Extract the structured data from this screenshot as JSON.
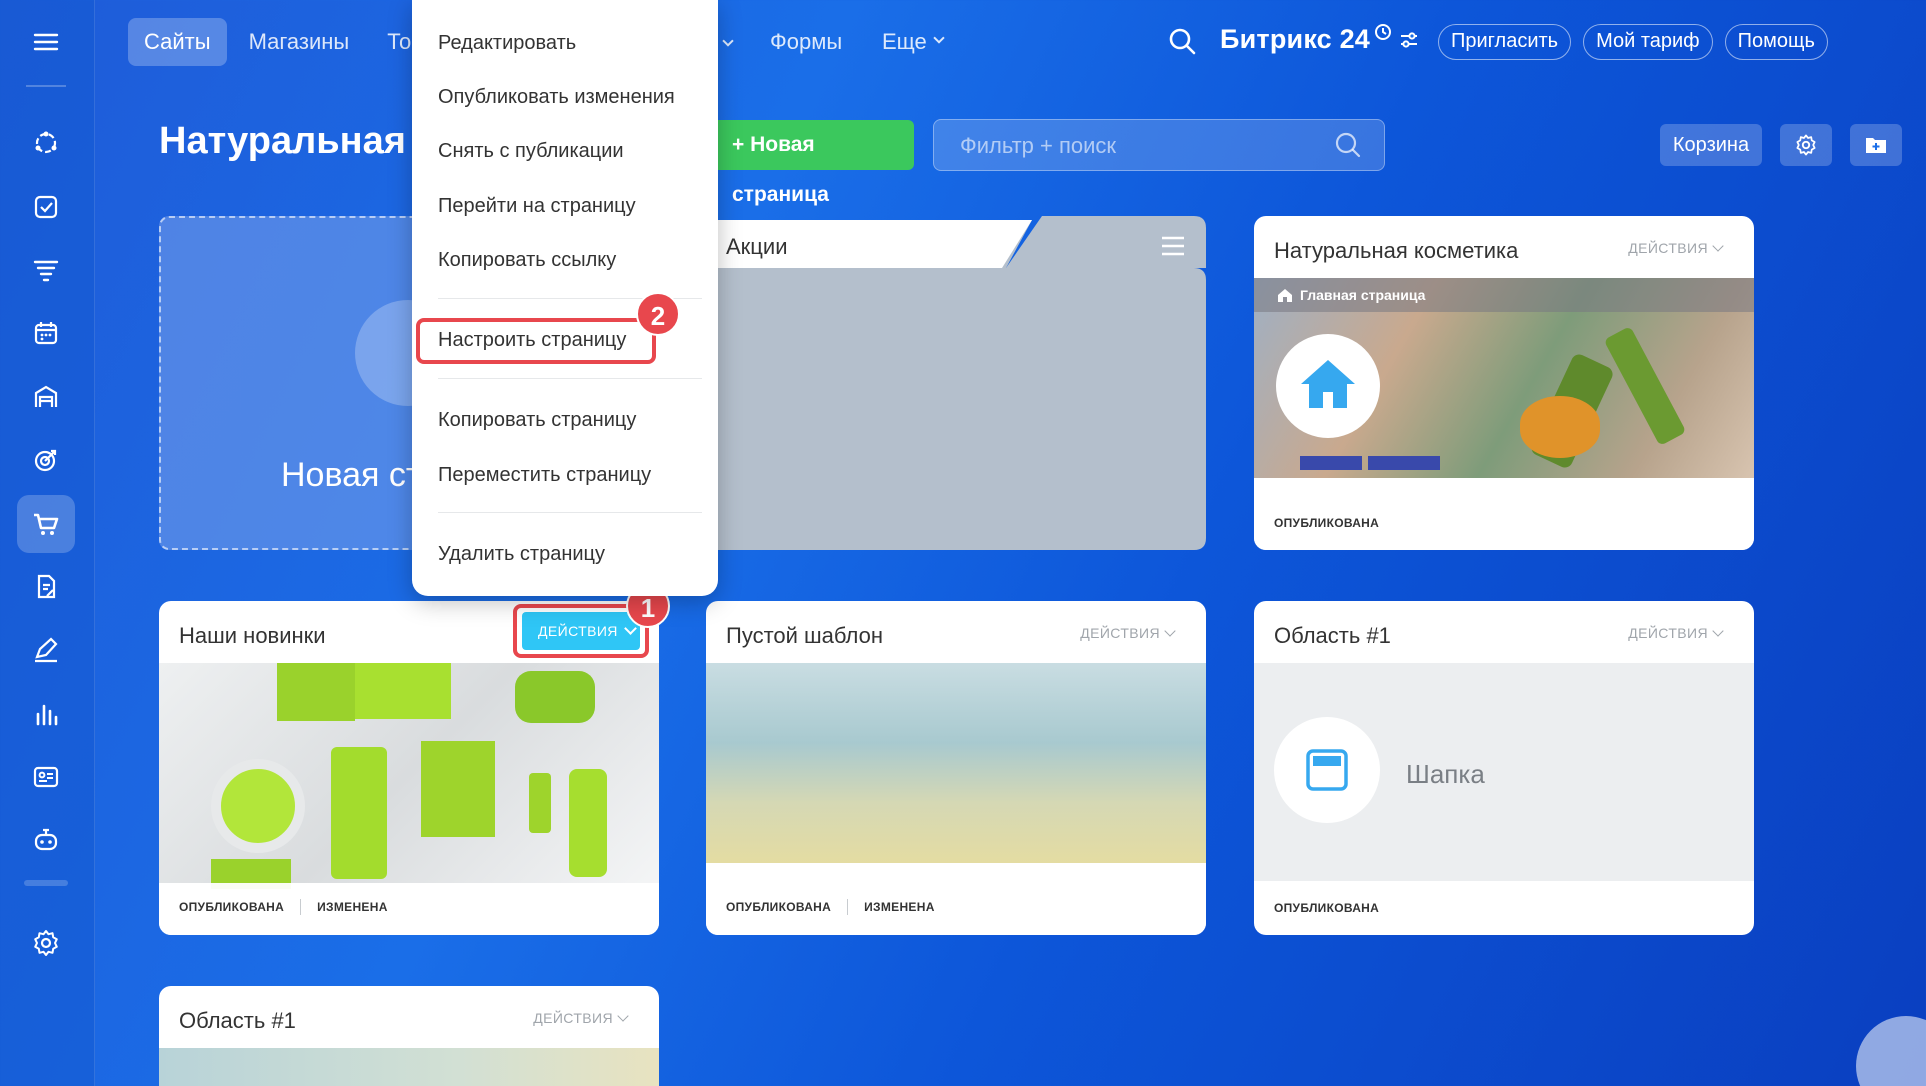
{
  "topnav": {
    "items": [
      {
        "label": "Сайты",
        "active": true
      },
      {
        "label": "Магазины"
      },
      {
        "label": "То"
      },
      {
        "label": "Формы"
      },
      {
        "label": "Еще",
        "has_dropdown": true
      }
    ]
  },
  "header": {
    "brand": "Битрикс 24",
    "invite": "Пригласить",
    "tariff": "Мой тариф",
    "help": "Помощь"
  },
  "toolbar": {
    "page_title": "Натуральная к",
    "new_page": "+ Новая страница",
    "filter_placeholder": "Фильтр + поиск",
    "trash": "Корзина"
  },
  "new_card": {
    "label": "Новая ст"
  },
  "menu": {
    "items": [
      "Редактировать",
      "Опубликовать изменения",
      "Снять с публикации",
      "Перейти на страницу",
      "Копировать ссылку",
      "Настроить страницу",
      "Копировать страницу",
      "Переместить страницу",
      "Удалить страницу"
    ]
  },
  "badges": {
    "one": "1",
    "two": "2"
  },
  "cards": {
    "folder": {
      "title": "Акции"
    },
    "cosmetics": {
      "title": "Натуральная косметика",
      "actions": "ДЕЙСТВИЯ",
      "home_label": "Главная страница",
      "status": "ОПУБЛИКОВАНА"
    },
    "novinki": {
      "title": "Наши новинки",
      "actions": "ДЕЙСТВИЯ",
      "status1": "ОПУБЛИКОВАНА",
      "status2": "ИЗМЕНЕНА"
    },
    "empty": {
      "title": "Пустой шаблон",
      "actions": "ДЕЙСТВИЯ",
      "status1": "ОПУБЛИКОВАНА",
      "status2": "ИЗМЕНЕНА"
    },
    "area1": {
      "title": "Область #1",
      "actions": "ДЕЙСТВИЯ",
      "block_label": "Шапка",
      "status": "ОПУБЛИКОВАНА"
    },
    "area1b": {
      "title": "Область #1",
      "actions": "ДЕЙСТВИЯ"
    }
  }
}
